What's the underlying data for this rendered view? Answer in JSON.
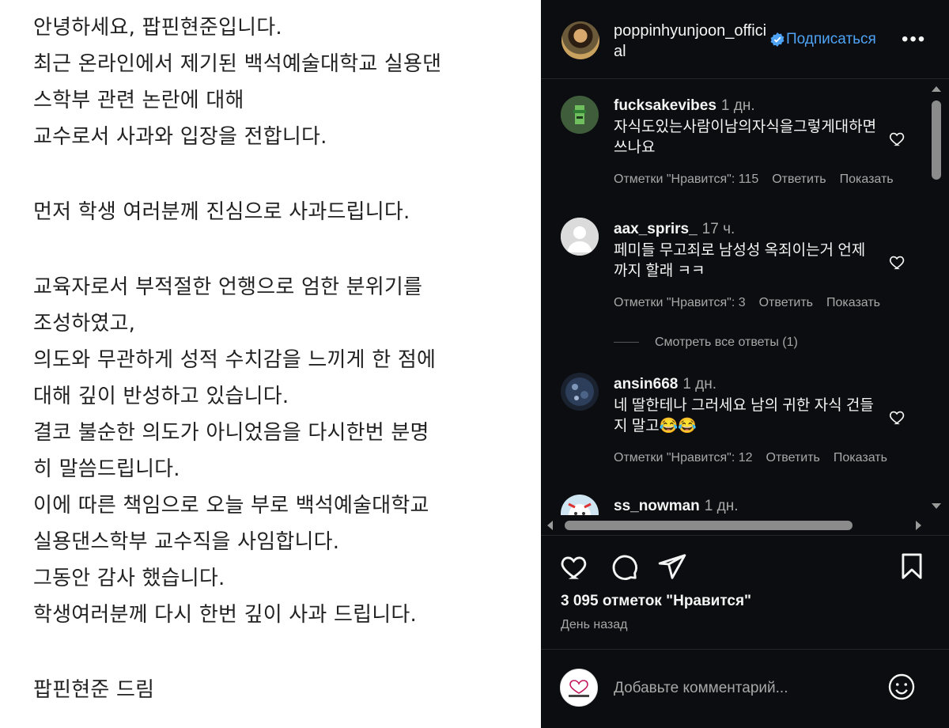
{
  "post_image": {
    "lines": [
      "안녕하세요, 팝핀현준입니다.",
      "최근 온라인에서 제기된 백석예술대학교 실용댄",
      "스학부 관련 논란에 대해",
      "교수로서 사과와 입장을 전합니다.",
      "",
      "먼저 학생 여러분께 진심으로 사과드립니다.",
      "",
      "교육자로서 부적절한 언행으로 엄한 분위기를",
      "조성하였고,",
      "의도와 무관하게 성적 수치감을 느끼게 한 점에",
      "대해 깊이 반성하고 있습니다.",
      "결코 불순한 의도가 아니었음을 다시한번 분명",
      "히 말씀드립니다.",
      "이에 따른 책임으로 오늘 부로 백석예술대학교",
      "실용댄스학부 교수직을 사임합니다.",
      "그동안 감사 했습니다.",
      "학생여러분께 다시 한번 깊이 사과 드립니다.",
      "",
      "팝핀현준 드림"
    ]
  },
  "header": {
    "username": "poppinhyunjoon_official",
    "follow_label": "Подписаться",
    "more_icon": "more-horizontal-icon",
    "verified_icon": "verified-badge-icon"
  },
  "comments": [
    {
      "username": "fucksakevibes",
      "time": "1 дн.",
      "text": "자식도있는사람이남의자식을그렇게대하면쓰나요",
      "likes": "Отметки \"Нравится\": 115",
      "reply": "Ответить",
      "show": "Показать"
    },
    {
      "username": "aax_sprirs_",
      "time": "17 ч.",
      "text": "페미들 무고죄로 남성성 옥죄이는거 언제까지 할래 ㅋㅋ",
      "likes": "Отметки \"Нравится\": 3",
      "reply": "Ответить",
      "show": "Показать"
    },
    {
      "username": "ansin668",
      "time": "1 дн.",
      "text": "네 딸한테나 그러세요 남의 귀한 자식 건들지 말고😂😂",
      "likes": "Отметки \"Нравится\": 12",
      "reply": "Ответить",
      "show": "Показать"
    },
    {
      "username": "ss_nowman",
      "time": "1 дн."
    }
  ],
  "view_replies": "Смотреть все ответы (1)",
  "actions": {
    "like_icon": "heart-icon",
    "comment_icon": "comment-icon",
    "share_icon": "share-icon",
    "save_icon": "bookmark-icon"
  },
  "likes_count": "3 095 отметок \"Нравится\"",
  "post_time": "День назад",
  "composer": {
    "placeholder": "Добавьте комментарий...",
    "emoji_icon": "emoji-icon"
  },
  "colors": {
    "panel_bg": "#0c0d10",
    "accent": "#4ea3f5",
    "muted": "#a8a8a8",
    "text": "#f5f5f5"
  }
}
